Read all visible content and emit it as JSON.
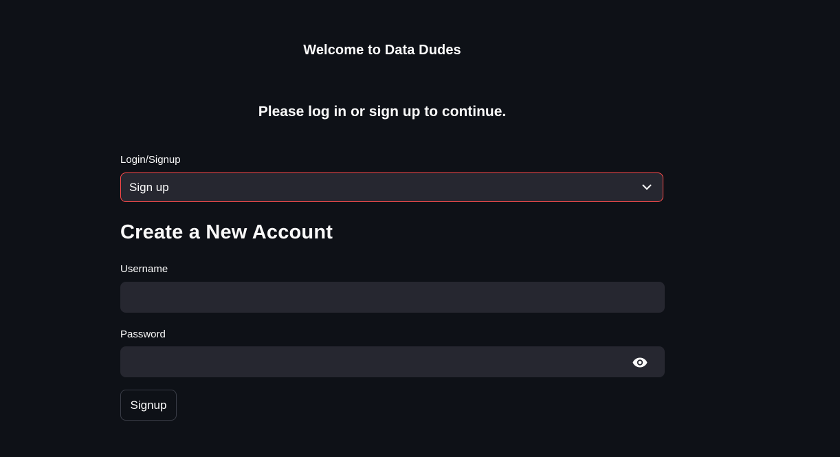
{
  "header": {
    "welcome": "Welcome to Data Dudes",
    "subtitle": "Please log in or sign up to continue."
  },
  "mode_select": {
    "label": "Login/Signup",
    "selected": "Sign up",
    "icon": "chevron-down-icon"
  },
  "form": {
    "title": "Create a New Account",
    "username_label": "Username",
    "username_value": "",
    "password_label": "Password",
    "password_value": "",
    "password_toggle_icon": "eye-icon",
    "submit_label": "Signup"
  },
  "colors": {
    "background": "#0e1117",
    "input_background": "#262730",
    "focus_border": "#ff4b4b",
    "text": "#fafafa"
  }
}
